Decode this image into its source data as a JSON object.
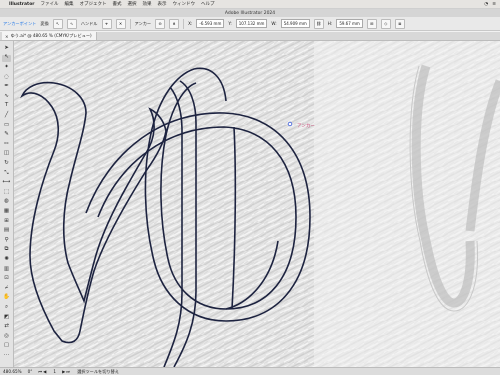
{
  "menubar": {
    "apple": "",
    "items": [
      "Illustrator",
      "ファイル",
      "編集",
      "オブジェクト",
      "書式",
      "選択",
      "効果",
      "表示",
      "ウィンドウ",
      "ヘルプ"
    ]
  },
  "window": {
    "title": "Adobe Illustrator 2024"
  },
  "controlbar": {
    "anchor_point_label": "アンカーポイント",
    "convert_label": "変換",
    "handle_label": "ハンドル",
    "anchor_label": "アンカー",
    "x_label": "X:",
    "x_value": "-6.593 mm",
    "y_label": "Y:",
    "y_value": "107.132 mm",
    "w_label": "W:",
    "w_value": "54.909 mm",
    "h_label": "H:",
    "h_value": "59.67 mm"
  },
  "document": {
    "tab_title": "ゆう.ai* @ 480.65 % (CMYK/プレビュー)"
  },
  "canvas": {
    "path_color": "#1d2340",
    "selection_color": "#3a5bd9",
    "hint_label": "アンカー"
  },
  "statusbar": {
    "zoom": "480.65%",
    "rotation": "0°",
    "artboard": "1",
    "tool_status": "選択ツールを切り替え"
  },
  "tools": [
    "selection-tool-icon",
    "direct-selection-tool-icon",
    "magic-wand-icon",
    "lasso-icon",
    "pen-tool-icon",
    "curvature-tool-icon",
    "type-tool-icon",
    "line-tool-icon",
    "rectangle-tool-icon",
    "paintbrush-icon",
    "pencil-icon",
    "eraser-icon",
    "rotate-tool-icon",
    "scale-tool-icon",
    "width-tool-icon",
    "free-transform-icon",
    "shape-builder-icon",
    "perspective-grid-icon",
    "mesh-tool-icon",
    "gradient-tool-icon",
    "eyedropper-icon",
    "blend-tool-icon",
    "symbol-sprayer-icon",
    "graph-tool-icon",
    "artboard-tool-icon",
    "slice-tool-icon",
    "hand-tool-icon",
    "zoom-tool-icon",
    "fill-stroke-icon",
    "swap-colors-icon",
    "draw-mode-icon",
    "screen-mode-icon",
    "edit-toolbar-icon"
  ]
}
